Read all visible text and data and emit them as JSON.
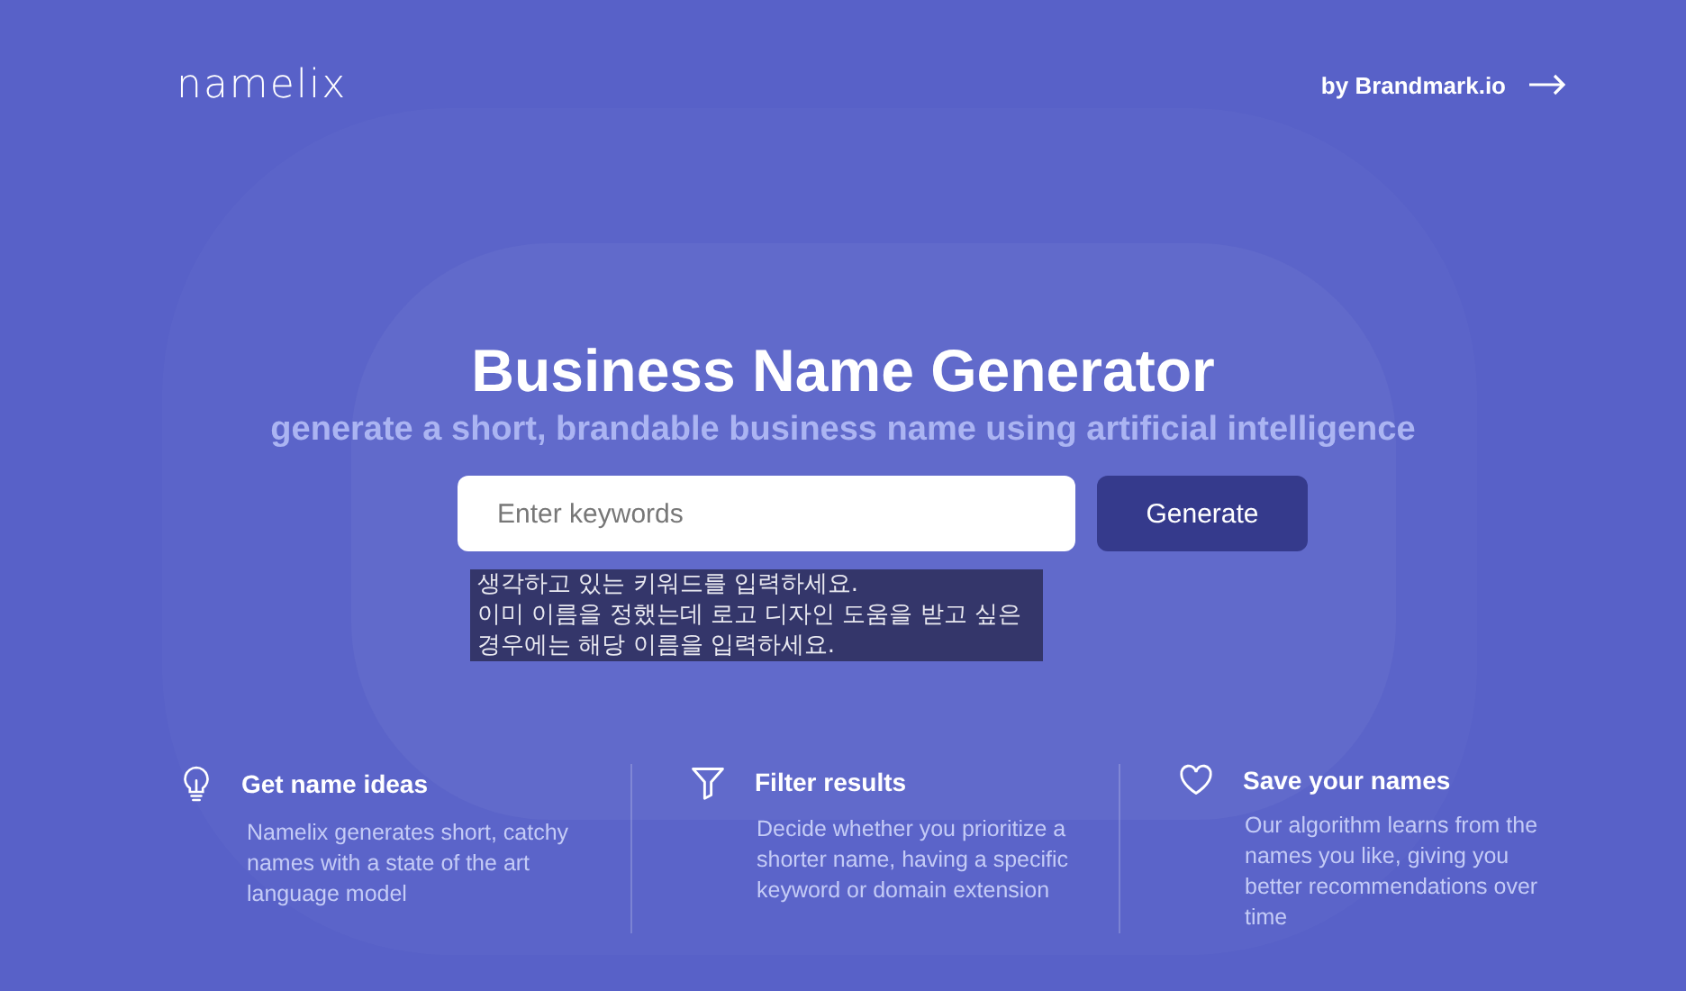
{
  "header": {
    "logo": "namelix",
    "link": "by Brandmark.io"
  },
  "hero": {
    "title": "Business Name Generator",
    "subtitle": "generate a short, brandable business name using artificial intelligence"
  },
  "search": {
    "placeholder": "Enter keywords",
    "button": "Generate"
  },
  "tooltip": {
    "lines": [
      "생각하고 있는 키워드를 입력하세요.",
      "이미 이름을 정했는데 로고 디자인 도움을 받고 싶은",
      "경우에는 해당 이름을 입력하세요."
    ]
  },
  "features": [
    {
      "kind": "bulb",
      "title": "Get name ideas",
      "text": "Namelix generates short, catchy names with a state of the art language model"
    },
    {
      "kind": "filter",
      "title": "Filter results",
      "text": "Decide whether you prioritize a shorter name, having a specific keyword or domain extension"
    },
    {
      "kind": "heart",
      "title": "Save your names",
      "text": "Our algorithm learns from the names you like, giving you better recommendations over time"
    }
  ]
}
